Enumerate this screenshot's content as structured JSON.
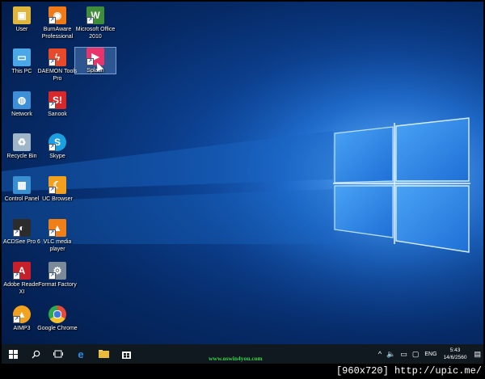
{
  "desktop": {
    "icons": [
      {
        "label": "User",
        "icon": "user-folder-icon",
        "color": "#e0b53c"
      },
      {
        "label": "BurnAware Professional",
        "icon": "burnaware-icon",
        "color": "#f07a18"
      },
      {
        "label": "Microsoft Office 2010",
        "icon": "office-icon",
        "color": "#3f8f3a"
      },
      {
        "label": "This PC",
        "icon": "computer-icon",
        "color": "#4aa8e8"
      },
      {
        "label": "DAEMON Tools Pro",
        "icon": "daemon-tools-icon",
        "color": "#e8492b"
      },
      {
        "label": "Splash",
        "icon": "splash-icon",
        "color": "#e8346a"
      },
      {
        "label": "Network",
        "icon": "network-icon",
        "color": "#3d8fd8"
      },
      {
        "label": "Sanook",
        "icon": "sanook-icon",
        "color": "#d8282a"
      },
      {
        "label": "Recycle Bin",
        "icon": "recycle-bin-icon",
        "color": "#9fb6c8"
      },
      {
        "label": "Skype",
        "icon": "skype-icon",
        "color": "#1c9fe0"
      },
      {
        "label": "Control Panel",
        "icon": "control-panel-icon",
        "color": "#3a8fd0"
      },
      {
        "label": "UC Browser",
        "icon": "uc-browser-icon",
        "color": "#f2a01e"
      },
      {
        "label": "ACDSee Pro 6",
        "icon": "acdsee-icon",
        "color": "#2c2c2c"
      },
      {
        "label": "VLC media player",
        "icon": "vlc-icon",
        "color": "#f07f18"
      },
      {
        "label": "Adobe Reader XI",
        "icon": "adobe-reader-icon",
        "color": "#c8202a"
      },
      {
        "label": "Format Factory",
        "icon": "format-factory-icon",
        "color": "#7a8a98"
      },
      {
        "label": "AIMP3",
        "icon": "aimp-icon",
        "color": "#f2a21e"
      },
      {
        "label": "Google Chrome",
        "icon": "chrome-icon",
        "color": "#e84a3a"
      }
    ]
  },
  "taskbar": {
    "start": "windows-start-icon",
    "search": "search-icon",
    "task_view": "task-view-icon",
    "pinned": [
      "edge-icon",
      "file-explorer-icon",
      "store-icon"
    ],
    "tray": {
      "language": "ENG",
      "time": "5:43",
      "date": "14/6/2560"
    }
  },
  "watermark": "www.oswin4you.com",
  "footer": "[960x720] http://upic.me/"
}
